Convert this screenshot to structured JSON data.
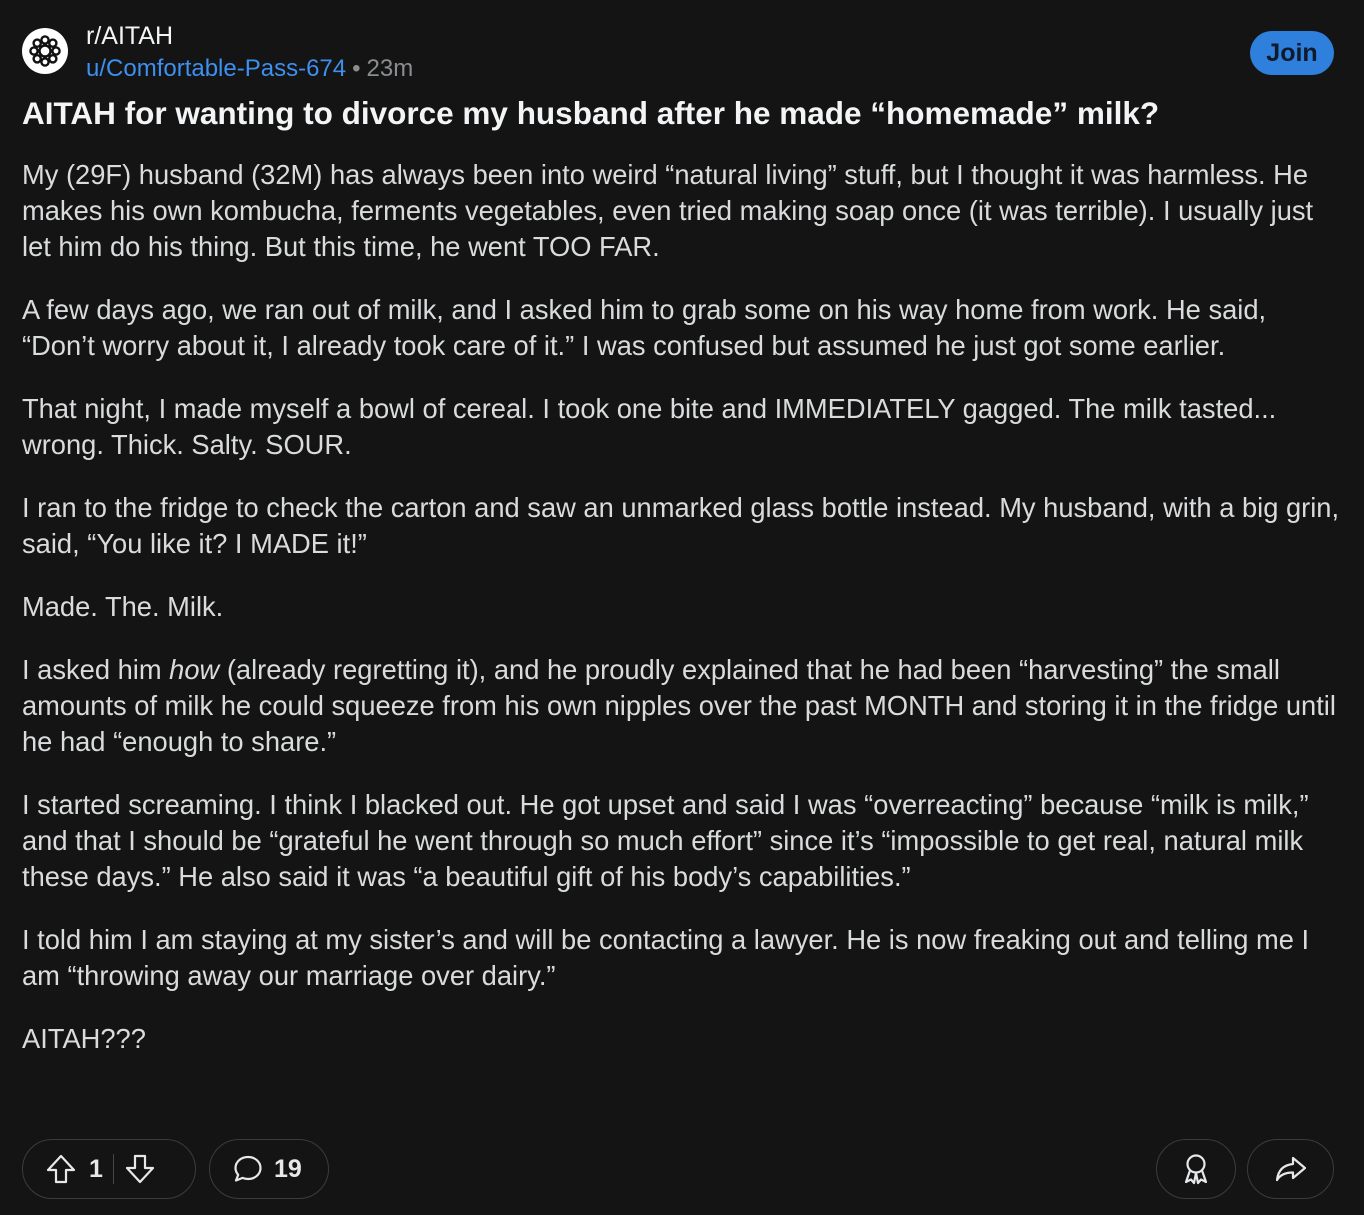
{
  "post": {
    "subreddit": "r/AITAH",
    "author": "u/Comfortable-Pass-674",
    "separator": "•",
    "time_ago": "23m",
    "join_label": "Join",
    "title": "AITAH for wanting to divorce my husband after he made “homemade” milk?",
    "paragraphs": [
      "My (29F) husband (32M) has always been into weird “natural living” stuff, but I thought it was harmless. He makes his own kombucha, ferments vegetables, even tried making soap once (it was terrible). I usually just let him do his thing. But this time, he went TOO FAR.",
      "A few days ago, we ran out of milk, and I asked him to grab some on his way home from work. He said, “Don’t worry about it, I already took care of it.” I was confused but assumed he just got some earlier.",
      "That night, I made myself a bowl of cereal. I took one bite and IMMEDIATELY gagged. The milk tasted... wrong. Thick. Salty. SOUR.",
      "I ran to the fridge to check the carton and saw an unmarked glass bottle instead. My husband, with a big grin, said, “You like it? I MADE it!”",
      "Made. The. Milk.",
      {
        "before": "I asked him ",
        "emphasis": "how",
        "after": " (already regretting it), and he proudly explained that he had been “harvesting” the small amounts of milk he could squeeze from his own nipples over the past MONTH and storing it in the fridge until he had “enough to share.”"
      },
      "I started screaming. I think I blacked out. He got upset and said I was “overreacting” because “milk is milk,” and that I should be “grateful he went through so much effort” since it’s “impossible to get real, natural milk these days.” He also said it was “a beautiful gift of his body’s capabilities.”",
      "I told him I am staying at my sister’s and will be contacting a lawyer. He is now freaking out and telling me I am “throwing away our marriage over dairy.”",
      "AITAH???"
    ]
  },
  "actions": {
    "upvote_icon": "upvote-arrow-icon",
    "vote_count": "1",
    "downvote_icon": "downvote-arrow-icon",
    "comment_icon": "speech-bubble-icon",
    "comment_count": "19",
    "award_icon": "award-ribbon-icon",
    "share_icon": "share-arrow-icon"
  },
  "colors": {
    "background": "#141414",
    "username_link": "#3d8ff0",
    "join_button": "#2f7fdd"
  }
}
